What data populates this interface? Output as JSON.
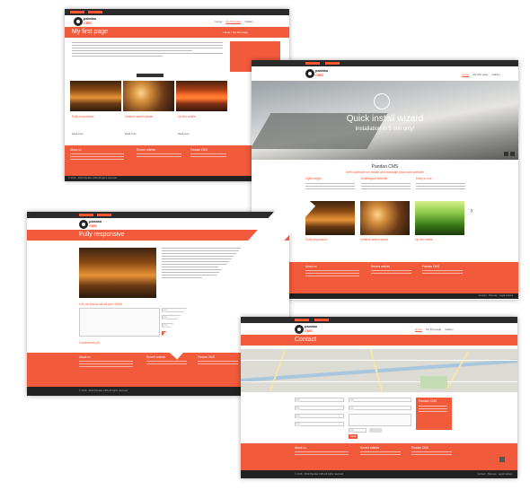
{
  "shots": {
    "first": {
      "title": "My first page",
      "crumb": "Home / My first page",
      "captions": [
        "Fully responsive",
        "Intuitive admin panel",
        "Up the article"
      ],
      "more": "Read more",
      "footer": [
        "About us",
        "Recent articles",
        "Pandao CMS"
      ],
      "copyright": "© 2016 - 2019 Pandao CMS All rights reserved",
      "bottom_links": [
        "Contact",
        "Sitemap",
        "Legal notices"
      ]
    },
    "home": {
      "hero_title": "Quick install wizard",
      "hero_sub": "Installation in 5 min only!",
      "section_title": "Pandao CMS",
      "section_sub": "Web software to create and manage your own website",
      "features": [
        "Light weight",
        "Multilingual website",
        "Easy to use"
      ],
      "captions": [
        "Fully responsive",
        "Intuitive admin panel",
        "Up the article"
      ],
      "footer": [
        "About us",
        "Recent articles",
        "Pandao CMS"
      ],
      "bottom_links": [
        "Contact",
        "Sitemap",
        "Legal notices"
      ]
    },
    "article": {
      "title": "Fully responsive",
      "comment_heading": "Let us know what you think",
      "comments_count": "Comments (0)",
      "send_label": "Send",
      "required_label": "Required field",
      "footer": [
        "About us",
        "Recent articles",
        "Pandao CMS"
      ],
      "copyright": "© 2016 - 2019 Pandao CMS All rights reserved",
      "bottom_links": [
        "Contact",
        "Sitemap",
        "Legal notices"
      ]
    },
    "contact": {
      "title": "Contact",
      "nav": [
        "Home",
        "My first page",
        "Gallery"
      ],
      "send_label": "Send",
      "box_title": "Pandao CMS",
      "footer": [
        "About us",
        "Recent articles",
        "Pandao CMS"
      ],
      "copyright": "© 2016 - 2019 Pandao CMS All rights reserved",
      "bottom_links": [
        "Contact",
        "Sitemap",
        "Legal notices"
      ]
    }
  },
  "brand": {
    "name": "pandao",
    "suffix": "CMS"
  },
  "colors": {
    "accent": "#f15a3a",
    "dark": "#222222"
  }
}
